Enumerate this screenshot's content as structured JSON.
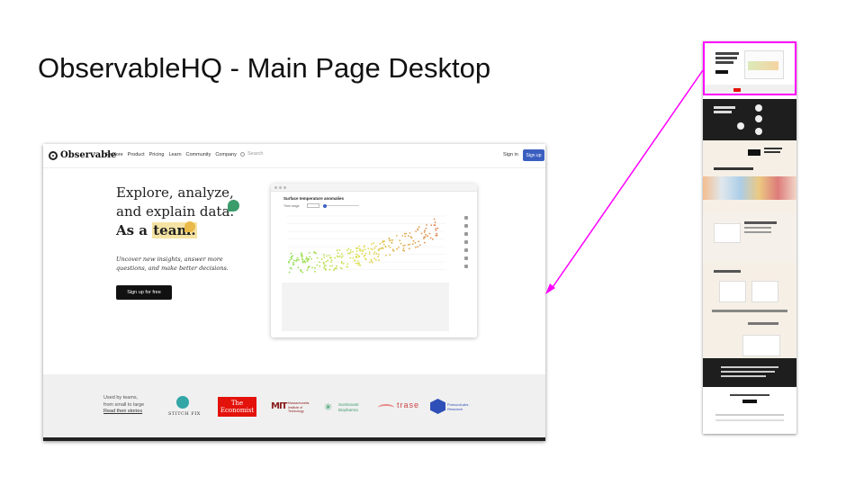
{
  "slide": {
    "title": "ObservableHQ - Main Page Desktop"
  },
  "nav": {
    "logo_text": "Observable",
    "links": [
      "Explore",
      "Product",
      "Pricing",
      "Learn",
      "Community",
      "Company"
    ],
    "search_label": "Search",
    "sign_in": "Sign in",
    "sign_up": "Sign up"
  },
  "hero": {
    "line1": "Explore, analyze,",
    "line2": "and explain data.",
    "line3_prefix": "As a ",
    "line3_emph": "team.",
    "subtitle": "Uncover new insights, answer more questions, and make better decisions.",
    "cta": "Sign up for free"
  },
  "card": {
    "title": "Surface temperature anomalies",
    "range_label": "Time range"
  },
  "customers": {
    "line1": "Used by teams,",
    "line2": "from small to large",
    "link": "Read their stories",
    "stitchfix": "STITCH FIX",
    "economist_1": "The",
    "economist_2": "Economist",
    "mit": "Massachusetts Institute of Technology",
    "sumitovant_1": "Sumitovant",
    "sumitovant_2": "Biopharma",
    "trase": "trase",
    "protocol_1": "ProtocolLabs",
    "protocol_2": "Research"
  },
  "colors": {
    "accent": "#3b5fc0",
    "highlight": "#ff00ff",
    "green": "#3a9b6b",
    "yellow": "#e9b94a"
  }
}
